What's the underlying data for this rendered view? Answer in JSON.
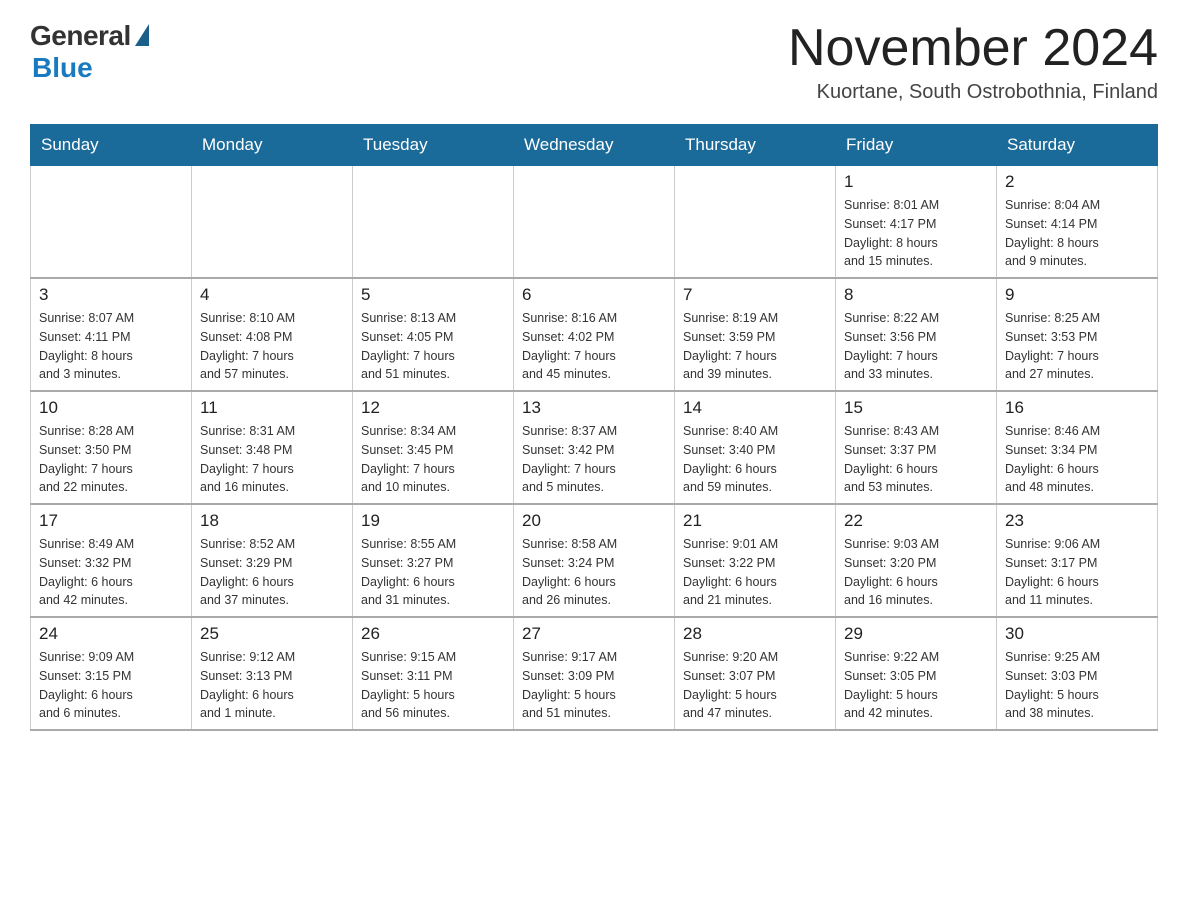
{
  "header": {
    "logo_general": "General",
    "logo_blue": "Blue",
    "month_title": "November 2024",
    "location": "Kuortane, South Ostrobothnia, Finland"
  },
  "weekdays": [
    "Sunday",
    "Monday",
    "Tuesday",
    "Wednesday",
    "Thursday",
    "Friday",
    "Saturday"
  ],
  "weeks": [
    [
      {
        "day": "",
        "info": ""
      },
      {
        "day": "",
        "info": ""
      },
      {
        "day": "",
        "info": ""
      },
      {
        "day": "",
        "info": ""
      },
      {
        "day": "",
        "info": ""
      },
      {
        "day": "1",
        "info": "Sunrise: 8:01 AM\nSunset: 4:17 PM\nDaylight: 8 hours\nand 15 minutes."
      },
      {
        "day": "2",
        "info": "Sunrise: 8:04 AM\nSunset: 4:14 PM\nDaylight: 8 hours\nand 9 minutes."
      }
    ],
    [
      {
        "day": "3",
        "info": "Sunrise: 8:07 AM\nSunset: 4:11 PM\nDaylight: 8 hours\nand 3 minutes."
      },
      {
        "day": "4",
        "info": "Sunrise: 8:10 AM\nSunset: 4:08 PM\nDaylight: 7 hours\nand 57 minutes."
      },
      {
        "day": "5",
        "info": "Sunrise: 8:13 AM\nSunset: 4:05 PM\nDaylight: 7 hours\nand 51 minutes."
      },
      {
        "day": "6",
        "info": "Sunrise: 8:16 AM\nSunset: 4:02 PM\nDaylight: 7 hours\nand 45 minutes."
      },
      {
        "day": "7",
        "info": "Sunrise: 8:19 AM\nSunset: 3:59 PM\nDaylight: 7 hours\nand 39 minutes."
      },
      {
        "day": "8",
        "info": "Sunrise: 8:22 AM\nSunset: 3:56 PM\nDaylight: 7 hours\nand 33 minutes."
      },
      {
        "day": "9",
        "info": "Sunrise: 8:25 AM\nSunset: 3:53 PM\nDaylight: 7 hours\nand 27 minutes."
      }
    ],
    [
      {
        "day": "10",
        "info": "Sunrise: 8:28 AM\nSunset: 3:50 PM\nDaylight: 7 hours\nand 22 minutes."
      },
      {
        "day": "11",
        "info": "Sunrise: 8:31 AM\nSunset: 3:48 PM\nDaylight: 7 hours\nand 16 minutes."
      },
      {
        "day": "12",
        "info": "Sunrise: 8:34 AM\nSunset: 3:45 PM\nDaylight: 7 hours\nand 10 minutes."
      },
      {
        "day": "13",
        "info": "Sunrise: 8:37 AM\nSunset: 3:42 PM\nDaylight: 7 hours\nand 5 minutes."
      },
      {
        "day": "14",
        "info": "Sunrise: 8:40 AM\nSunset: 3:40 PM\nDaylight: 6 hours\nand 59 minutes."
      },
      {
        "day": "15",
        "info": "Sunrise: 8:43 AM\nSunset: 3:37 PM\nDaylight: 6 hours\nand 53 minutes."
      },
      {
        "day": "16",
        "info": "Sunrise: 8:46 AM\nSunset: 3:34 PM\nDaylight: 6 hours\nand 48 minutes."
      }
    ],
    [
      {
        "day": "17",
        "info": "Sunrise: 8:49 AM\nSunset: 3:32 PM\nDaylight: 6 hours\nand 42 minutes."
      },
      {
        "day": "18",
        "info": "Sunrise: 8:52 AM\nSunset: 3:29 PM\nDaylight: 6 hours\nand 37 minutes."
      },
      {
        "day": "19",
        "info": "Sunrise: 8:55 AM\nSunset: 3:27 PM\nDaylight: 6 hours\nand 31 minutes."
      },
      {
        "day": "20",
        "info": "Sunrise: 8:58 AM\nSunset: 3:24 PM\nDaylight: 6 hours\nand 26 minutes."
      },
      {
        "day": "21",
        "info": "Sunrise: 9:01 AM\nSunset: 3:22 PM\nDaylight: 6 hours\nand 21 minutes."
      },
      {
        "day": "22",
        "info": "Sunrise: 9:03 AM\nSunset: 3:20 PM\nDaylight: 6 hours\nand 16 minutes."
      },
      {
        "day": "23",
        "info": "Sunrise: 9:06 AM\nSunset: 3:17 PM\nDaylight: 6 hours\nand 11 minutes."
      }
    ],
    [
      {
        "day": "24",
        "info": "Sunrise: 9:09 AM\nSunset: 3:15 PM\nDaylight: 6 hours\nand 6 minutes."
      },
      {
        "day": "25",
        "info": "Sunrise: 9:12 AM\nSunset: 3:13 PM\nDaylight: 6 hours\nand 1 minute."
      },
      {
        "day": "26",
        "info": "Sunrise: 9:15 AM\nSunset: 3:11 PM\nDaylight: 5 hours\nand 56 minutes."
      },
      {
        "day": "27",
        "info": "Sunrise: 9:17 AM\nSunset: 3:09 PM\nDaylight: 5 hours\nand 51 minutes."
      },
      {
        "day": "28",
        "info": "Sunrise: 9:20 AM\nSunset: 3:07 PM\nDaylight: 5 hours\nand 47 minutes."
      },
      {
        "day": "29",
        "info": "Sunrise: 9:22 AM\nSunset: 3:05 PM\nDaylight: 5 hours\nand 42 minutes."
      },
      {
        "day": "30",
        "info": "Sunrise: 9:25 AM\nSunset: 3:03 PM\nDaylight: 5 hours\nand 38 minutes."
      }
    ]
  ]
}
